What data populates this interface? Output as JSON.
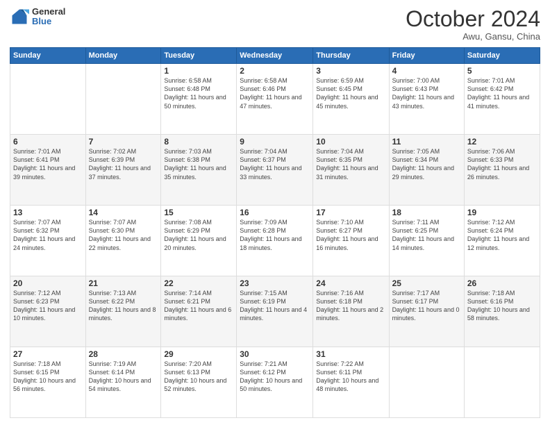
{
  "header": {
    "logo_general": "General",
    "logo_blue": "Blue",
    "month_title": "October 2024",
    "location": "Awu, Gansu, China"
  },
  "weekdays": [
    "Sunday",
    "Monday",
    "Tuesday",
    "Wednesday",
    "Thursday",
    "Friday",
    "Saturday"
  ],
  "weeks": [
    [
      {
        "day": "",
        "info": ""
      },
      {
        "day": "",
        "info": ""
      },
      {
        "day": "1",
        "info": "Sunrise: 6:58 AM\nSunset: 6:48 PM\nDaylight: 11 hours and 50 minutes."
      },
      {
        "day": "2",
        "info": "Sunrise: 6:58 AM\nSunset: 6:46 PM\nDaylight: 11 hours and 47 minutes."
      },
      {
        "day": "3",
        "info": "Sunrise: 6:59 AM\nSunset: 6:45 PM\nDaylight: 11 hours and 45 minutes."
      },
      {
        "day": "4",
        "info": "Sunrise: 7:00 AM\nSunset: 6:43 PM\nDaylight: 11 hours and 43 minutes."
      },
      {
        "day": "5",
        "info": "Sunrise: 7:01 AM\nSunset: 6:42 PM\nDaylight: 11 hours and 41 minutes."
      }
    ],
    [
      {
        "day": "6",
        "info": "Sunrise: 7:01 AM\nSunset: 6:41 PM\nDaylight: 11 hours and 39 minutes."
      },
      {
        "day": "7",
        "info": "Sunrise: 7:02 AM\nSunset: 6:39 PM\nDaylight: 11 hours and 37 minutes."
      },
      {
        "day": "8",
        "info": "Sunrise: 7:03 AM\nSunset: 6:38 PM\nDaylight: 11 hours and 35 minutes."
      },
      {
        "day": "9",
        "info": "Sunrise: 7:04 AM\nSunset: 6:37 PM\nDaylight: 11 hours and 33 minutes."
      },
      {
        "day": "10",
        "info": "Sunrise: 7:04 AM\nSunset: 6:35 PM\nDaylight: 11 hours and 31 minutes."
      },
      {
        "day": "11",
        "info": "Sunrise: 7:05 AM\nSunset: 6:34 PM\nDaylight: 11 hours and 29 minutes."
      },
      {
        "day": "12",
        "info": "Sunrise: 7:06 AM\nSunset: 6:33 PM\nDaylight: 11 hours and 26 minutes."
      }
    ],
    [
      {
        "day": "13",
        "info": "Sunrise: 7:07 AM\nSunset: 6:32 PM\nDaylight: 11 hours and 24 minutes."
      },
      {
        "day": "14",
        "info": "Sunrise: 7:07 AM\nSunset: 6:30 PM\nDaylight: 11 hours and 22 minutes."
      },
      {
        "day": "15",
        "info": "Sunrise: 7:08 AM\nSunset: 6:29 PM\nDaylight: 11 hours and 20 minutes."
      },
      {
        "day": "16",
        "info": "Sunrise: 7:09 AM\nSunset: 6:28 PM\nDaylight: 11 hours and 18 minutes."
      },
      {
        "day": "17",
        "info": "Sunrise: 7:10 AM\nSunset: 6:27 PM\nDaylight: 11 hours and 16 minutes."
      },
      {
        "day": "18",
        "info": "Sunrise: 7:11 AM\nSunset: 6:25 PM\nDaylight: 11 hours and 14 minutes."
      },
      {
        "day": "19",
        "info": "Sunrise: 7:12 AM\nSunset: 6:24 PM\nDaylight: 11 hours and 12 minutes."
      }
    ],
    [
      {
        "day": "20",
        "info": "Sunrise: 7:12 AM\nSunset: 6:23 PM\nDaylight: 11 hours and 10 minutes."
      },
      {
        "day": "21",
        "info": "Sunrise: 7:13 AM\nSunset: 6:22 PM\nDaylight: 11 hours and 8 minutes."
      },
      {
        "day": "22",
        "info": "Sunrise: 7:14 AM\nSunset: 6:21 PM\nDaylight: 11 hours and 6 minutes."
      },
      {
        "day": "23",
        "info": "Sunrise: 7:15 AM\nSunset: 6:19 PM\nDaylight: 11 hours and 4 minutes."
      },
      {
        "day": "24",
        "info": "Sunrise: 7:16 AM\nSunset: 6:18 PM\nDaylight: 11 hours and 2 minutes."
      },
      {
        "day": "25",
        "info": "Sunrise: 7:17 AM\nSunset: 6:17 PM\nDaylight: 11 hours and 0 minutes."
      },
      {
        "day": "26",
        "info": "Sunrise: 7:18 AM\nSunset: 6:16 PM\nDaylight: 10 hours and 58 minutes."
      }
    ],
    [
      {
        "day": "27",
        "info": "Sunrise: 7:18 AM\nSunset: 6:15 PM\nDaylight: 10 hours and 56 minutes."
      },
      {
        "day": "28",
        "info": "Sunrise: 7:19 AM\nSunset: 6:14 PM\nDaylight: 10 hours and 54 minutes."
      },
      {
        "day": "29",
        "info": "Sunrise: 7:20 AM\nSunset: 6:13 PM\nDaylight: 10 hours and 52 minutes."
      },
      {
        "day": "30",
        "info": "Sunrise: 7:21 AM\nSunset: 6:12 PM\nDaylight: 10 hours and 50 minutes."
      },
      {
        "day": "31",
        "info": "Sunrise: 7:22 AM\nSunset: 6:11 PM\nDaylight: 10 hours and 48 minutes."
      },
      {
        "day": "",
        "info": ""
      },
      {
        "day": "",
        "info": ""
      }
    ]
  ]
}
